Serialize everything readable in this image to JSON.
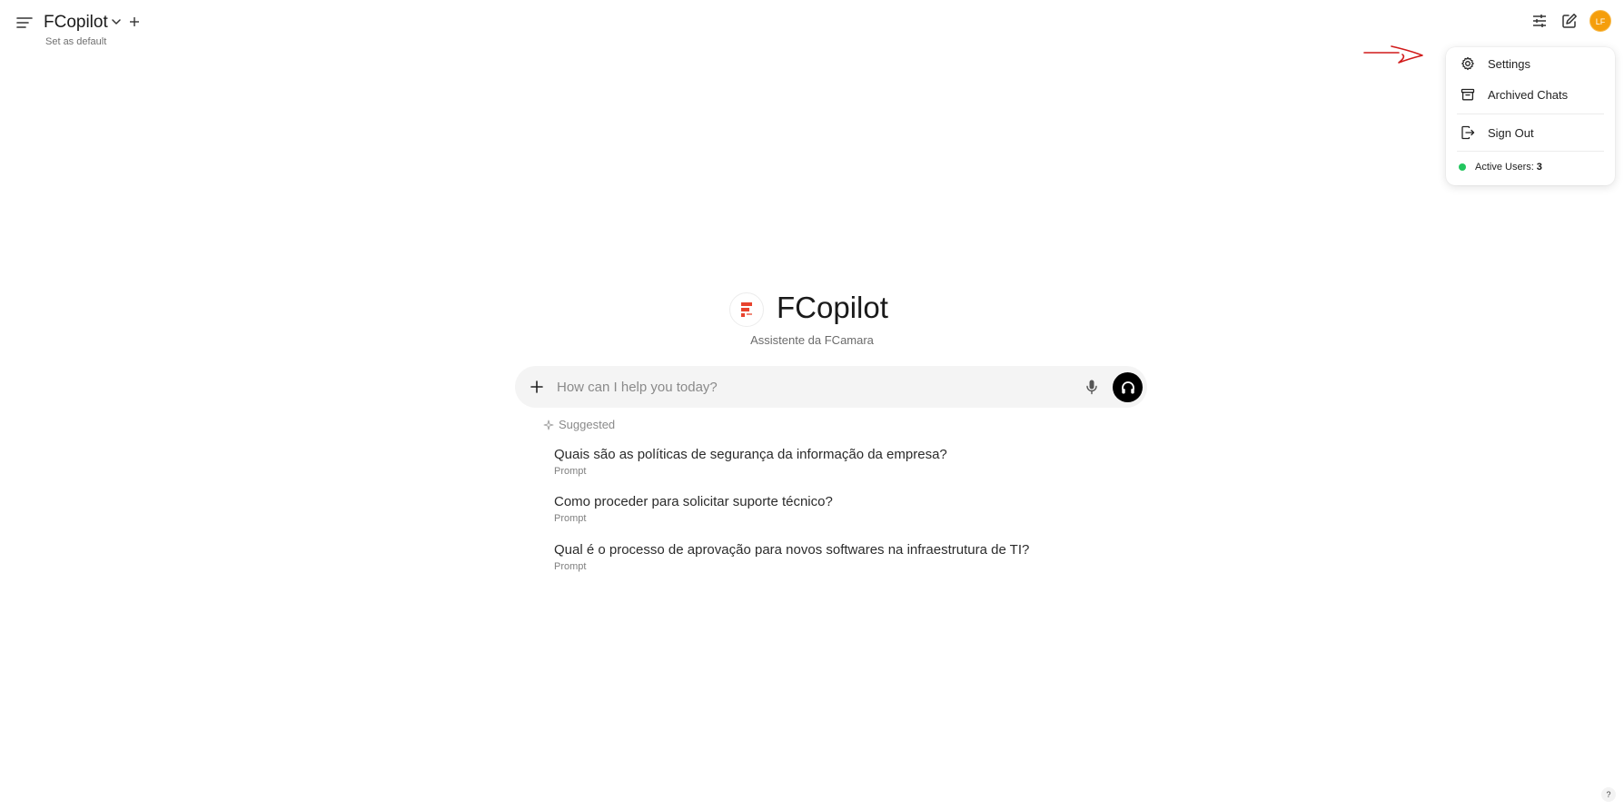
{
  "header": {
    "model_name": "FCopilot",
    "set_default_label": "Set as default",
    "avatar_initials": "LF"
  },
  "icons": {
    "menu": "menu-icon",
    "chevron": "chevron-down-icon",
    "new_model": "plus-icon",
    "controls": "sliders-icon",
    "new_chat": "pencil-square-icon",
    "settings": "gear-icon",
    "archive": "archive-icon",
    "sign_out": "sign-out-icon",
    "attach": "plus-icon",
    "mic": "microphone-icon",
    "voice": "headphones-icon",
    "suggested": "sparkle-icon"
  },
  "user_menu": {
    "items": [
      {
        "label": "Settings"
      },
      {
        "label": "Archived Chats"
      },
      {
        "label": "Sign Out"
      }
    ],
    "active_users_label": "Active Users:",
    "active_users_count": "3"
  },
  "hero": {
    "title": "FCopilot",
    "subtitle": "Assistente da FCamara"
  },
  "chat_input": {
    "placeholder": "How can I help you today?"
  },
  "suggestions": {
    "heading": "Suggested",
    "items": [
      {
        "text": "Quais são as políticas de segurança da informação da empresa?",
        "tag": "Prompt"
      },
      {
        "text": "Como proceder para solicitar suporte técnico?",
        "tag": "Prompt"
      },
      {
        "text": "Qual é o processo de aprovação para novos softwares na infraestrutura de TI?",
        "tag": "Prompt"
      }
    ]
  },
  "help": {
    "label": "?"
  },
  "colors": {
    "accent_avatar": "#f59e0b",
    "annotation_arrow": "#d11a1a",
    "online_dot": "#22c55e",
    "brand_logo": "#e8432e"
  }
}
